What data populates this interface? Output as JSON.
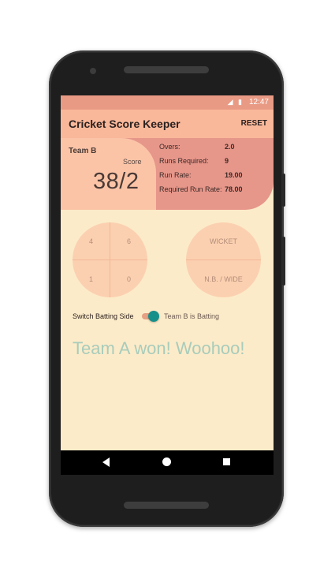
{
  "status_bar": {
    "time": "12:47",
    "icons": [
      "signal-icon",
      "battery-icon"
    ]
  },
  "app_bar": {
    "title": "Cricket Score Keeper",
    "reset_label": "RESET"
  },
  "score_card": {
    "team": "Team B",
    "score_label": "Score",
    "score": "38/2"
  },
  "stats": [
    {
      "label": "Overs:",
      "value": "2.0"
    },
    {
      "label": "Runs Required:",
      "value": "9"
    },
    {
      "label": "Run Rate:",
      "value": "19.00"
    },
    {
      "label": "Required Run Rate:",
      "value": "78.00"
    }
  ],
  "runs_pad": {
    "top_left": "4",
    "top_right": "6",
    "bottom_left": "1",
    "bottom_right": "0"
  },
  "extras_pad": {
    "top": "WICKET",
    "bottom": "N.B. / WIDE"
  },
  "batting_switch": {
    "label": "Switch Batting Side",
    "status": "Team B is Batting",
    "on": true
  },
  "result": "Team A won! Woohoo!",
  "colors": {
    "status_bar": "#e99a84",
    "app_bar": "#f9b89a",
    "stats_panel": "#e7968a",
    "score_card": "#fbc4a7",
    "background": "#fcebc9",
    "switch_thumb": "#17908a",
    "result_text": "#a8ccbb"
  }
}
